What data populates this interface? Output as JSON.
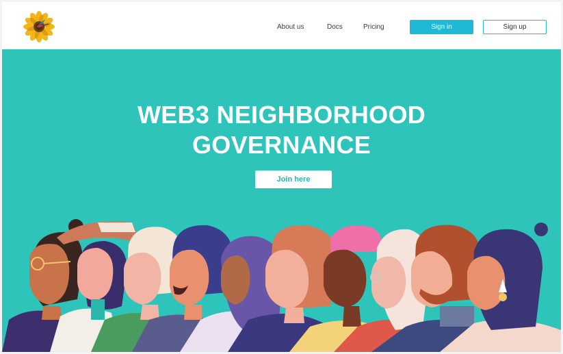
{
  "header": {
    "logo_icon": "sunflower-hummingbird-logo",
    "nav": [
      {
        "label": "About us"
      },
      {
        "label": "Docs"
      },
      {
        "label": "Pricing"
      }
    ],
    "sign_in_label": "Sign in",
    "sign_up_label": "Sign up"
  },
  "hero": {
    "title_line1": "WEB3 NEIGHBORHOOD",
    "title_line2": "GOVERNANCE",
    "join_label": "Join here",
    "illustration": "crowd-of-diverse-people-illustration"
  },
  "colors": {
    "accent": "#1fb8d6",
    "hero_bg": "#2ec4b9",
    "text_dark": "#333a44",
    "white": "#ffffff"
  }
}
